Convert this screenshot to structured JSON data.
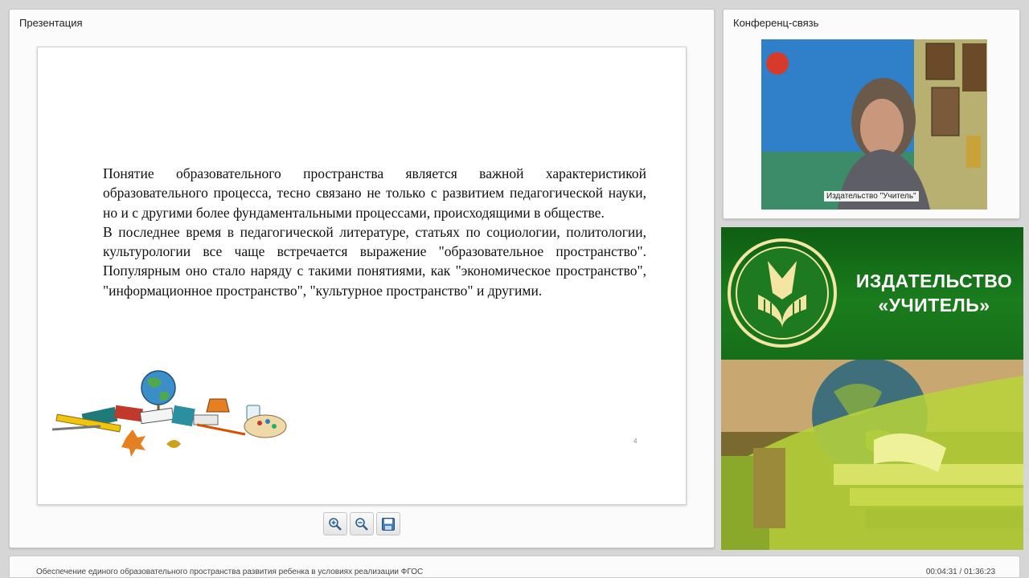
{
  "presentation": {
    "panel_title": "Презентация",
    "slide": {
      "paragraphs": [
        "Понятие образовательного пространства является важной характеристикой образовательного процесса, тесно связано не только с развитием педагогической науки, но и с другими более фундаментальными процессами, происходящими в обществе.",
        "В последнее время в педагогической литературе, статьях по социологии, политологии, культурологии все чаще встречается выражение \"образовательное пространство\". Популярным оно стало наряду с такими понятиями, как \"экономическое пространство\", \"информационное пространство\", \"культурное пространство\" и другими."
      ],
      "page_number": "4",
      "illustration": "school-supplies-clipart"
    },
    "toolbar": [
      {
        "name": "zoom-in-icon"
      },
      {
        "name": "zoom-out-icon"
      },
      {
        "name": "save-icon"
      }
    ]
  },
  "conference": {
    "panel_title": "Конференц-связь",
    "video_label": "Издательство \"Учитель\""
  },
  "brand": {
    "line1": "ИЗДАТЕЛЬСТВО",
    "line2": "«УЧИТЕЛЬ»",
    "logo": "uchitel-logo"
  },
  "footer": {
    "title": "Обеспечение единого образовательного пространства развития ребенка в условиях реализации ФГОС",
    "time": "00:04:31 / 01:36:23"
  },
  "colors": {
    "brand_green": "#1a7c1d",
    "panel_bg": "#fbfbfb",
    "app_bg": "#d6d6d6"
  }
}
